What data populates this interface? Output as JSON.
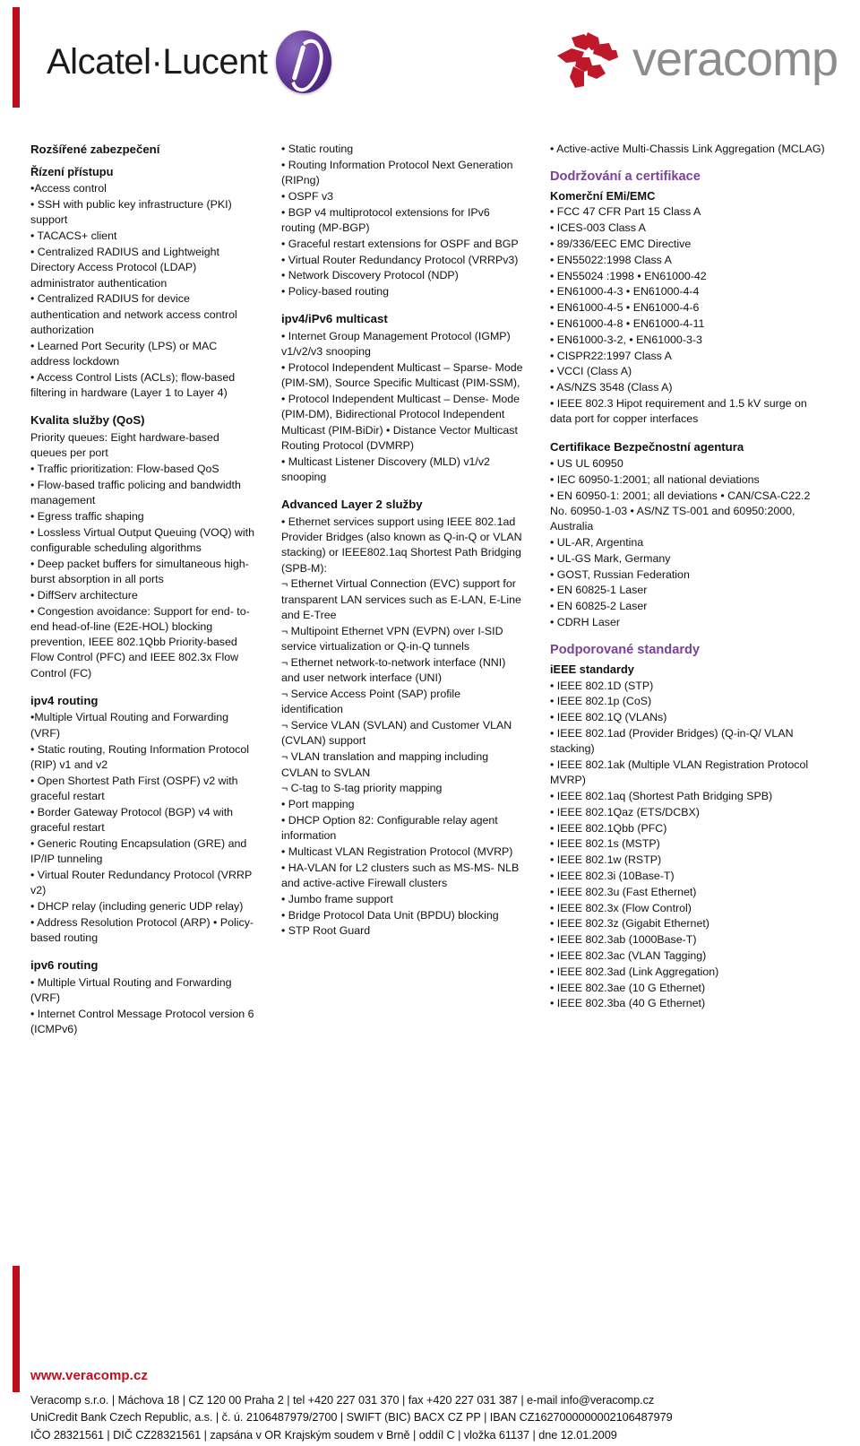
{
  "header": {
    "alcatel_lucent_logo_text": "Alcatel·Lucent",
    "veracomp_logo_text": "veracomp",
    "accent_red": "#c00d1e",
    "alu_purple": "#6b3fa0",
    "veracomp_grey": "#8c8c8c"
  },
  "column1": {
    "title": "Rozšířené zabezpečení",
    "section_access": {
      "heading": "Řízení přístupu",
      "items": [
        "•Access control",
        "• SSH with public key infrastructure (PKI) support",
        "• TACACS+ client",
        "• Centralized RADIUS and Lightweight Directory Access Protocol (LDAP) administrator authentication",
        "• Centralized RADIUS for device authentication and network access control authorization",
        "• Learned Port Security (LPS) or MAC address lockdown",
        "• Access Control Lists (ACLs); flow-based filtering in hardware (Layer 1 to Layer 4)"
      ]
    },
    "section_qos": {
      "heading": "Kvalita služby (QoS)",
      "items": [
        "Priority queues: Eight hardware-based queues per port",
        "• Traffic prioritization: Flow-based QoS",
        "• Flow-based traffic policing and bandwidth management",
        "• Egress traffic shaping",
        "• Lossless Virtual Output Queuing (VOQ) with configurable scheduling algorithms",
        "• Deep packet buffers for simultaneous high-burst absorption in all ports",
        "• DiffServ architecture",
        "• Congestion avoidance: Support for end- to-end head-of-line (E2E-HOL) blocking prevention, IEEE 802.1Qbb Priority-based Flow Control (PFC) and IEEE 802.3x Flow Control (FC)"
      ]
    },
    "section_ipv4": {
      "heading": "ipv4 routing",
      "items": [
        "•Multiple Virtual Routing and Forwarding (VRF)",
        "• Static routing, Routing Information Protocol (RIP) v1 and v2",
        "• Open Shortest Path First (OSPF) v2 with graceful restart",
        "• Border Gateway Protocol (BGP) v4 with graceful restart",
        "• Generic Routing Encapsulation (GRE) and IP/IP tunneling",
        "• Virtual Router Redundancy Protocol (VRRP v2)",
        "• DHCP relay (including generic UDP relay)",
        "• Address Resolution Protocol (ARP) • Policy-based routing"
      ]
    },
    "section_ipv6": {
      "heading": "ipv6 routing",
      "items": [
        "• Multiple Virtual Routing and Forwarding (VRF)",
        "• Internet Control Message Protocol version 6 (ICMPv6)"
      ]
    }
  },
  "column2": {
    "top_items": [
      "• Static routing",
      "• Routing Information Protocol Next Generation (RIPng)",
      "• OSPF v3",
      "• BGP v4 multiprotocol extensions for IPv6 routing (MP-BGP)",
      "• Graceful restart extensions for OSPF and BGP",
      "• Virtual Router Redundancy Protocol (VRRPv3)",
      "• Network Discovery Protocol (NDP)",
      "• Policy-based routing"
    ],
    "section_multicast": {
      "heading": "ipv4/iPv6 multicast",
      "items": [
        "• Internet Group Management Protocol (IGMP) v1/v2/v3 snooping",
        "• Protocol Independent Multicast – Sparse- Mode (PIM-SM), Source Specific Multicast (PIM-SSM),",
        "• Protocol Independent Multicast – Dense- Mode (PIM-DM), Bidirectional Protocol Independent Multicast (PIM-BiDir) • Distance Vector Multicast Routing Protocol (DVMRP)",
        "• Multicast Listener Discovery (MLD) v1/v2 snooping"
      ]
    },
    "section_layer2": {
      "heading": "Advanced Layer 2 služby",
      "items": [
        "• Ethernet services support using IEEE 802.1ad Provider Bridges (also known as Q-in-Q or VLAN stacking) or IEEE802.1aq Shortest Path Bridging (SPB-M):",
        "¬ Ethernet Virtual Connection (EVC) support for transparent LAN services such as E-LAN, E-Line and E-Tree",
        "¬ Multipoint Ethernet VPN (EVPN) over I-SID service virtualization or Q-in-Q tunnels",
        "¬ Ethernet network-to-network interface (NNI) and user network interface (UNI)",
        "¬ Service Access Point (SAP) profile identification",
        "¬ Service VLAN (SVLAN) and Customer VLAN (CVLAN) support",
        "¬ VLAN translation and mapping including CVLAN to SVLAN",
        "¬ C-tag to S-tag priority mapping",
        "• Port mapping",
        "• DHCP Option 82: Configurable relay agent information",
        "• Multicast VLAN Registration Protocol (MVRP)",
        "• HA-VLAN for L2 clusters such as MS-MS- NLB and active-active Firewall clusters",
        "• Jumbo frame support",
        "• Bridge Protocol Data Unit (BPDU) blocking",
        "• STP Root Guard"
      ]
    }
  },
  "column3": {
    "top_items": [
      "• Active-active Multi-Chassis Link Aggregation (MCLAG)"
    ],
    "section_compliance": {
      "heading": "Dodržování a certifikace",
      "sub_heading": "Komerční EMi/EMC",
      "items": [
        "• FCC 47 CFR Part 15 Class A",
        "• ICES-003 Class A",
        "• 89/336/EEC EMC Directive",
        "• EN55022:1998 Class A",
        "• EN55024 :1998 • EN61000-42",
        "• EN61000-4-3 • EN61000-4-4",
        "• EN61000-4-5 • EN61000-4-6",
        "• EN61000-4-8 • EN61000-4-11",
        "• EN61000-3-2, • EN61000-3-3",
        "• CISPR22:1997 Class A",
        "• VCCI (Class A)",
        "• AS/NZS 3548 (Class A)",
        "• IEEE 802.3 Hipot requirement and 1.5 kV surge on data port for copper interfaces"
      ]
    },
    "section_safety": {
      "heading": "Certifikace Bezpečnostní agentura",
      "items": [
        "• US UL 60950",
        "• IEC 60950-1:2001; all national deviations",
        "• EN 60950-1: 2001; all deviations • CAN/CSA-C22.2 No. 60950-1-03 • AS/NZ TS-001 and 60950:2000, Australia",
        "• UL-AR, Argentina",
        "• UL-GS Mark, Germany",
        "• GOST, Russian Federation",
        "• EN 60825-1 Laser",
        "• EN 60825-2 Laser",
        "• CDRH Laser"
      ]
    },
    "section_standards": {
      "heading": "Podporované standardy",
      "sub_heading": "iEEE standardy",
      "items": [
        "• IEEE 802.1D (STP)",
        "• IEEE 802.1p (CoS)",
        "• IEEE 802.1Q (VLANs)",
        "• IEEE 802.1ad (Provider Bridges) (Q-in-Q/ VLAN stacking)",
        "• IEEE 802.1ak (Multiple VLAN Registration Protocol MVRP)",
        "• IEEE 802.1aq (Shortest Path Bridging SPB)",
        "• IEEE 802.1Qaz (ETS/DCBX)",
        "• IEEE 802.1Qbb (PFC)",
        "• IEEE 802.1s (MSTP)",
        "• IEEE 802.1w (RSTP)",
        "• IEEE 802.3i (10Base-T)",
        "• IEEE 802.3u (Fast Ethernet)",
        "• IEEE 802.3x (Flow Control)",
        "• IEEE 802.3z (Gigabit Ethernet)",
        "• IEEE 802.3ab (1000Base-T)",
        "• IEEE 802.3ac (VLAN Tagging)",
        "• IEEE 802.3ad (Link Aggregation)",
        "• IEEE 802.3ae (10 G Ethernet)",
        "• IEEE 802.3ba (40 G Ethernet)"
      ]
    }
  },
  "footer": {
    "website": "www.veracomp.cz",
    "line1": "Veracomp s.r.o.  |  Máchova 18  |  CZ 120 00 Praha 2  |  tel +420 227 031 370  |  fax +420 227 031 387  |  e-mail  info@veracomp.cz",
    "line2": "UniCredit Bank Czech Republic, a.s.  |  č. ú. 2106487979/2700  |  SWIFT (BIC) BACX CZ PP  |  IBAN CZ1627000000002106487979",
    "line3": "IČO 28321561  |  DIČ CZ28321561  |  zapsána v OR Krajským soudem v Brně  |  oddíl C  |  vložka 61137  |  dne 12.01.2009"
  }
}
